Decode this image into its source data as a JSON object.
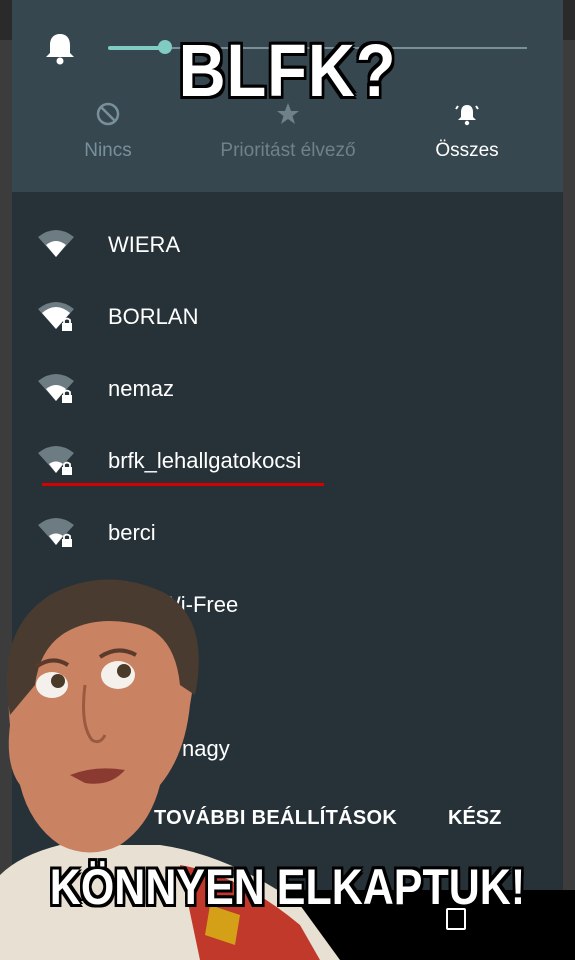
{
  "meme": {
    "top_text": "BLFK?",
    "bottom_text": "KÖNNYEN ELKAPTUK!"
  },
  "sound": {
    "icon": "bell-icon",
    "volume_fraction": 0.13
  },
  "interruption_modes": [
    {
      "label": "Nincs",
      "icon": "no-entry-icon"
    },
    {
      "label": "Prioritást élvező",
      "icon": "star-icon"
    },
    {
      "label": "Összes",
      "icon": "bell-ring-icon",
      "selected": true
    }
  ],
  "wifi_networks": [
    {
      "name": "WIERA",
      "locked": false
    },
    {
      "name": "BORLAN",
      "locked": true
    },
    {
      "name": "nemaz",
      "locked": true
    },
    {
      "name": "brfk_lehallgatokocsi",
      "locked": true,
      "highlighted": true
    },
    {
      "name": "berci",
      "locked": true
    },
    {
      "name": "Wi-Free",
      "locked": false
    },
    {
      "name": "nagy",
      "locked": false
    }
  ],
  "actions": {
    "more_settings": "TOVÁBBI BEÁLLÍTÁSOK",
    "done": "KÉSZ"
  },
  "colors": {
    "panel_bg": "#263238",
    "header_bg": "#37474f",
    "accent": "#80cbc4",
    "highlight_underline": "#d50000"
  }
}
